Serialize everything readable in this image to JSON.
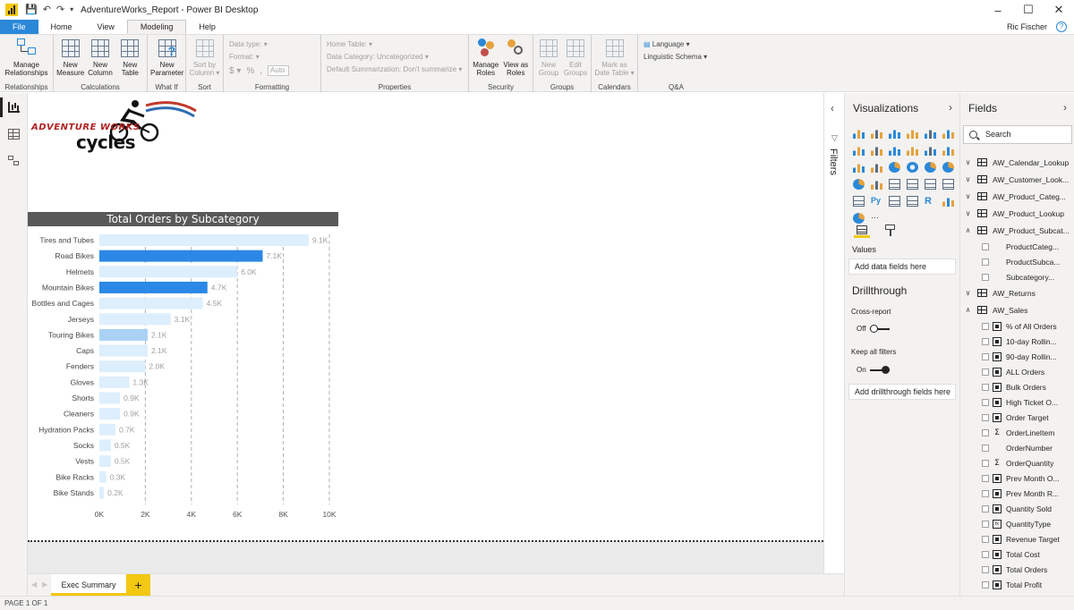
{
  "window": {
    "title": "AdventureWorks_Report - Power BI Desktop",
    "user": "Ric Fischer",
    "controls": [
      "–",
      "☐",
      "✕"
    ]
  },
  "ribbon_tabs": [
    {
      "label": "File"
    },
    {
      "label": "Home"
    },
    {
      "label": "View"
    },
    {
      "label": "Modeling"
    },
    {
      "label": "Help"
    }
  ],
  "ribbon": {
    "relationships": {
      "label": "Relationships",
      "manage": "Manage\nRelationships"
    },
    "calculations": {
      "label": "Calculations",
      "new_measure": "New\nMeasure",
      "new_column": "New\nColumn",
      "new_table": "New\nTable"
    },
    "whatif": {
      "label": "What If",
      "new_parameter": "New\nParameter"
    },
    "sort": {
      "label": "Sort",
      "sort_by_column": "Sort by\nColumn ▾"
    },
    "formatting": {
      "label": "Formatting",
      "data_type": "Data type: ▾",
      "format": "Format: ▾",
      "auto": "Auto",
      "currency": "$ ▾",
      "percent": "%",
      "comma": ","
    },
    "properties": {
      "label": "Properties",
      "home_table": "Home Table: ▾",
      "data_category": "Data Category: Uncategorized ▾",
      "default_summarization": "Default Summarization: Don't summarize ▾"
    },
    "security": {
      "label": "Security",
      "manage_roles": "Manage\nRoles",
      "view_as_roles": "View as\nRoles"
    },
    "groups": {
      "label": "Groups",
      "new_group": "New\nGroup",
      "edit_groups": "Edit\nGroups"
    },
    "calendars": {
      "label": "Calendars",
      "mark_as_date_table": "Mark as\nDate Table ▾"
    },
    "qa": {
      "label": "Q&A",
      "language": "Language ▾",
      "linguistic_schema": "Linguistic Schema ▾"
    }
  },
  "logo": {
    "line1": "ADVENTURE WORKS",
    "line2": "cycles"
  },
  "chart_data": {
    "type": "bar",
    "title": "Total Orders by Subcategory",
    "categories": [
      "Tires and Tubes",
      "Road Bikes",
      "Helmets",
      "Mountain Bikes",
      "Bottles and Cages",
      "Jerseys",
      "Touring Bikes",
      "Caps",
      "Fenders",
      "Gloves",
      "Shorts",
      "Cleaners",
      "Hydration Packs",
      "Socks",
      "Vests",
      "Bike Racks",
      "Bike Stands"
    ],
    "values": [
      9100,
      7100,
      6000,
      4700,
      4500,
      3100,
      2100,
      2100,
      2000,
      1300,
      900,
      900,
      700,
      500,
      500,
      300,
      200
    ],
    "data_labels": [
      "9.1K",
      "7.1K",
      "6.0K",
      "4.7K",
      "4.5K",
      "3.1K",
      "2.1K",
      "2.1K",
      "2.0K",
      "1.3K",
      "0.9K",
      "0.9K",
      "0.7K",
      "0.5K",
      "0.5K",
      "0.3K",
      "0.2K"
    ],
    "highlight": [
      "light",
      "dark",
      "light",
      "dark",
      "light",
      "light",
      "mid",
      "light",
      "light",
      "light",
      "light",
      "light",
      "light",
      "light",
      "light",
      "light",
      "light"
    ],
    "colors": {
      "light": "#ddeefc",
      "mid": "#a9d2f5",
      "dark": "#2b88e6"
    },
    "xlim": [
      0,
      10000
    ],
    "xticks": [
      0,
      2000,
      4000,
      6000,
      8000,
      10000
    ],
    "xtick_labels": [
      "0K",
      "2K",
      "4K",
      "6K",
      "8K",
      "10K"
    ],
    "grid": true,
    "orientation": "horizontal"
  },
  "page_tabs": [
    {
      "label": "Exec Summary"
    }
  ],
  "add_page": "+",
  "status": "PAGE 1 OF 1",
  "filters": {
    "label": "Filters"
  },
  "visualizations": {
    "title": "Visualizations",
    "values_label": "Values",
    "values_placeholder": "Add data fields here",
    "drillthrough_title": "Drillthrough",
    "cross_report": "Cross-report",
    "cross_report_state": "Off",
    "keep_all_filters": "Keep all filters",
    "keep_all_filters_state": "On",
    "drillthrough_placeholder": "Add drillthrough fields here",
    "more": "···"
  },
  "fields": {
    "title": "Fields",
    "search_placeholder": "Search",
    "items": [
      {
        "kind": "table",
        "name": "AW_Calendar_Lookup",
        "expander": "∨"
      },
      {
        "kind": "table",
        "name": "AW_Customer_Look...",
        "expander": "∨"
      },
      {
        "kind": "table",
        "name": "AW_Product_Categ...",
        "expander": "∨"
      },
      {
        "kind": "table",
        "name": "AW_Product_Lookup",
        "expander": "∨"
      },
      {
        "kind": "table",
        "name": "AW_Product_Subcat...",
        "expander": "∧"
      },
      {
        "kind": "field",
        "icon": "none",
        "name": "ProductCateg..."
      },
      {
        "kind": "field",
        "icon": "none",
        "name": "ProductSubca..."
      },
      {
        "kind": "field",
        "icon": "none",
        "name": "Subcategory..."
      },
      {
        "kind": "table",
        "name": "AW_Returns",
        "expander": "∨"
      },
      {
        "kind": "table",
        "name": "AW_Sales",
        "expander": "∧"
      },
      {
        "kind": "field",
        "icon": "calc",
        "name": "% of All Orders"
      },
      {
        "kind": "field",
        "icon": "calc",
        "name": "10-day Rollin..."
      },
      {
        "kind": "field",
        "icon": "calc",
        "name": "90-day Rollin..."
      },
      {
        "kind": "field",
        "icon": "calc",
        "name": "ALL Orders"
      },
      {
        "kind": "field",
        "icon": "calc",
        "name": "Bulk Orders"
      },
      {
        "kind": "field",
        "icon": "calc",
        "name": "High Ticket O..."
      },
      {
        "kind": "field",
        "icon": "calc",
        "name": "Order Target"
      },
      {
        "kind": "field",
        "icon": "sum",
        "name": "OrderLineItem"
      },
      {
        "kind": "field",
        "icon": "none",
        "name": "OrderNumber"
      },
      {
        "kind": "field",
        "icon": "sum",
        "name": "OrderQuantity"
      },
      {
        "kind": "field",
        "icon": "calc",
        "name": "Prev Month O..."
      },
      {
        "kind": "field",
        "icon": "calc",
        "name": "Prev Month R..."
      },
      {
        "kind": "field",
        "icon": "calc",
        "name": "Quantity Sold"
      },
      {
        "kind": "field",
        "icon": "typ",
        "name": "QuantityType"
      },
      {
        "kind": "field",
        "icon": "calc",
        "name": "Revenue Target"
      },
      {
        "kind": "field",
        "icon": "calc",
        "name": "Total Cost"
      },
      {
        "kind": "field",
        "icon": "calc",
        "name": "Total Orders"
      },
      {
        "kind": "field",
        "icon": "calc",
        "name": "Total Profit"
      }
    ]
  }
}
